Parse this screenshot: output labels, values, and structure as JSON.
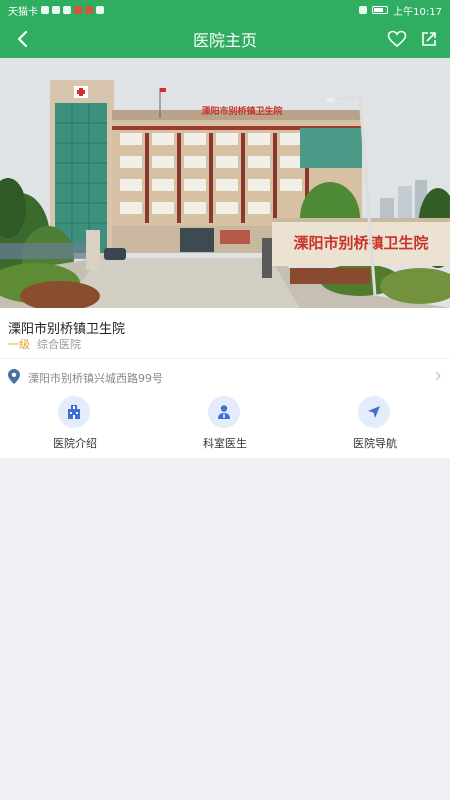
{
  "statusbar": {
    "carrier": "天猫卡",
    "time": "上午10:17"
  },
  "navbar": {
    "title": "医院主页"
  },
  "hero": {
    "sign_text": "溧阳市别桥镇卫生院"
  },
  "hospital": {
    "name": "溧阳市别桥镇卫生院",
    "level": "一级",
    "type": "综合医院",
    "address": "溧阳市别桥镇兴城西路99号"
  },
  "actions": [
    {
      "label": "医院介绍",
      "icon": "hospital-building-icon"
    },
    {
      "label": "科室医生",
      "icon": "doctor-icon"
    },
    {
      "label": "医院导航",
      "icon": "navigation-arrow-icon"
    }
  ],
  "colors": {
    "primary": "#2fae61",
    "level": "#e2a128",
    "action_bg": "#e3ecfb",
    "action_icon": "#3d6fd0"
  }
}
